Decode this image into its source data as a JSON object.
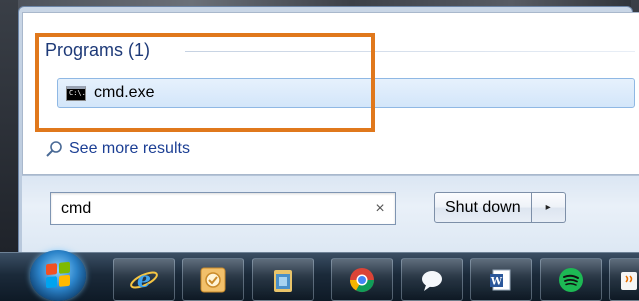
{
  "start_menu": {
    "programs_header": "Programs (1)",
    "results": [
      {
        "label": "cmd.exe",
        "icon": "cmd-icon",
        "icon_text": "C:\\."
      }
    ],
    "see_more": "See more results",
    "search": {
      "value": "cmd",
      "clear_glyph": "×"
    },
    "shutdown": {
      "label": "Shut down",
      "arrow_glyph": "▸"
    }
  },
  "taskbar": {
    "pinned": [
      "internet-explorer-icon",
      "outlook-icon",
      "windows-explorer-icon",
      "chrome-icon",
      "chat-icon",
      "word-icon",
      "spotify-icon",
      "java-icon"
    ]
  },
  "colors": {
    "highlight": "#e0781c",
    "header_text": "#1e3a78",
    "link_text": "#1c3f94",
    "selection_border": "#8fb8e4"
  }
}
